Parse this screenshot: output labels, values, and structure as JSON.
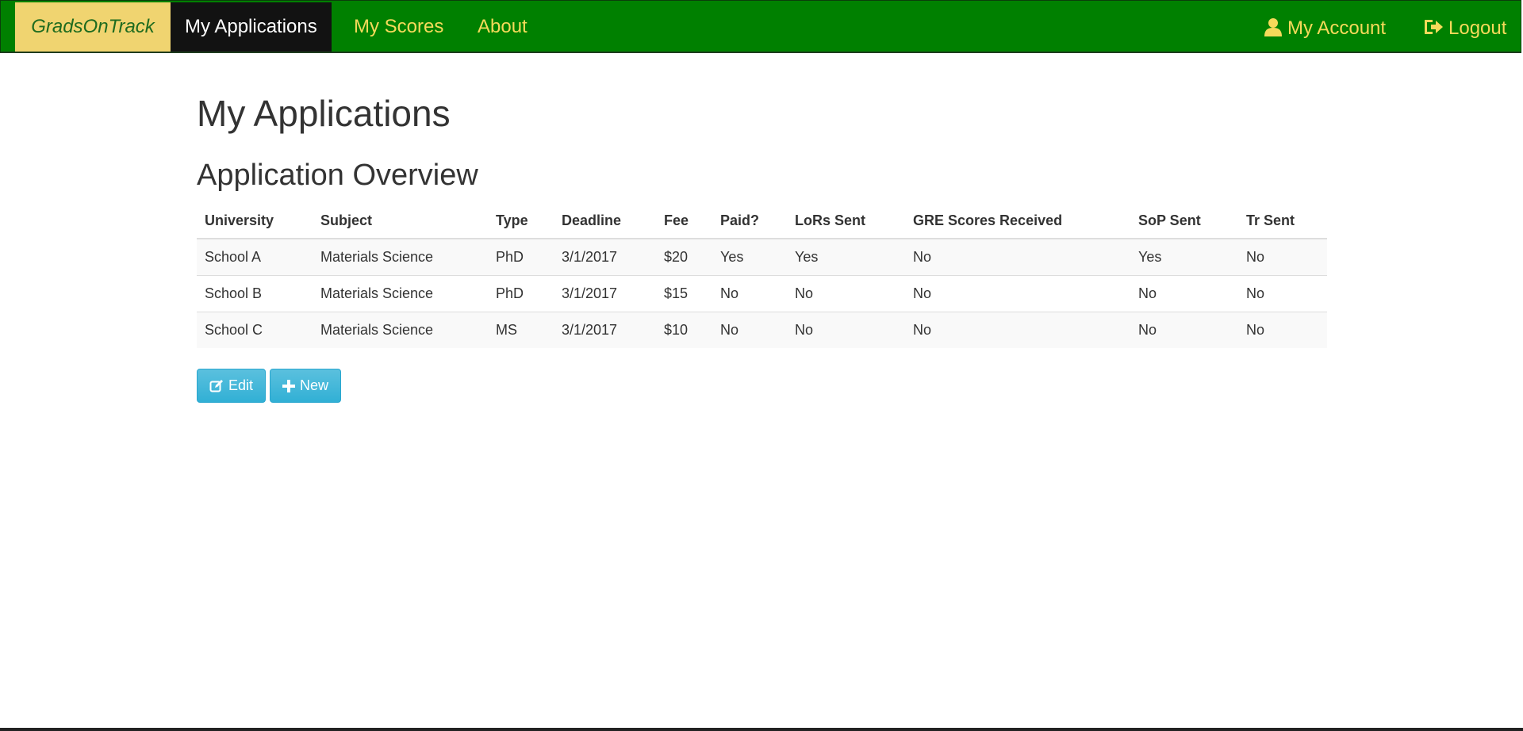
{
  "nav": {
    "brand": "GradsOnTrack",
    "items": [
      {
        "label": "My Applications",
        "active": true
      },
      {
        "label": "My Scores",
        "active": false
      },
      {
        "label": "About",
        "active": false
      }
    ],
    "account_label": "My Account",
    "logout_label": "Logout"
  },
  "page": {
    "title": "My Applications",
    "section_title": "Application Overview"
  },
  "table": {
    "headers": [
      "University",
      "Subject",
      "Type",
      "Deadline",
      "Fee",
      "Paid?",
      "LoRs Sent",
      "GRE Scores Received",
      "SoP Sent",
      "Tr Sent"
    ],
    "rows": [
      [
        "School A",
        "Materials Science",
        "PhD",
        "3/1/2017",
        "$20",
        "Yes",
        "Yes",
        "No",
        "Yes",
        "No"
      ],
      [
        "School B",
        "Materials Science",
        "PhD",
        "3/1/2017",
        "$15",
        "No",
        "No",
        "No",
        "No",
        "No"
      ],
      [
        "School C",
        "Materials Science",
        "MS",
        "3/1/2017",
        "$10",
        "No",
        "No",
        "No",
        "No",
        "No"
      ]
    ]
  },
  "buttons": {
    "edit_label": "Edit",
    "new_label": "New"
  },
  "colors": {
    "navbar": "#008000",
    "brand_bg": "#f0d470",
    "nav_text": "#f5da5a",
    "button": "#5bc0de"
  }
}
